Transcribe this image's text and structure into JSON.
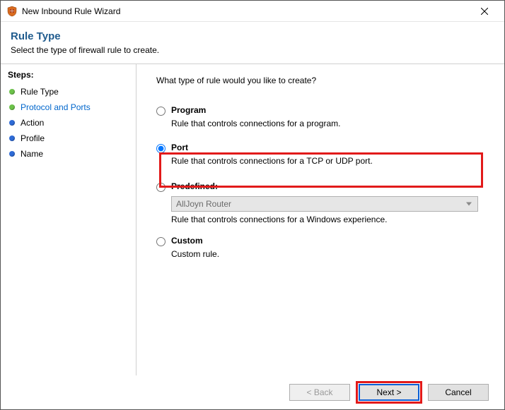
{
  "window": {
    "title": "New Inbound Rule Wizard"
  },
  "header": {
    "title": "Rule Type",
    "subtitle": "Select the type of firewall rule to create."
  },
  "sidebar": {
    "title": "Steps:",
    "items": [
      {
        "label": "Rule Type",
        "dot": "green",
        "active_class": ""
      },
      {
        "label": "Protocol and Ports",
        "dot": "green",
        "active_class": "active"
      },
      {
        "label": "Action",
        "dot": "blue",
        "active_class": ""
      },
      {
        "label": "Profile",
        "dot": "blue",
        "active_class": ""
      },
      {
        "label": "Name",
        "dot": "blue",
        "active_class": ""
      }
    ]
  },
  "main": {
    "question": "What type of rule would you like to create?",
    "options": {
      "program": {
        "label": "Program",
        "desc": "Rule that controls connections for a program."
      },
      "port": {
        "label": "Port",
        "desc": "Rule that controls connections for a TCP or UDP port."
      },
      "predefined": {
        "label": "Predefined:",
        "selected": "AllJoyn Router",
        "desc": "Rule that controls connections for a Windows experience."
      },
      "custom": {
        "label": "Custom",
        "desc": "Custom rule."
      }
    }
  },
  "footer": {
    "back": "< Back",
    "next": "Next >",
    "cancel": "Cancel"
  }
}
